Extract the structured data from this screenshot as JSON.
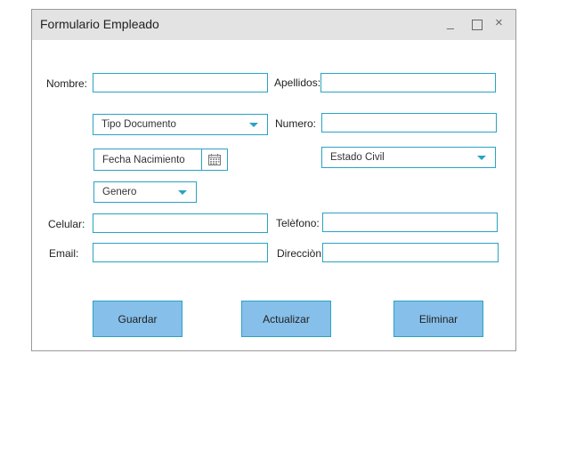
{
  "window": {
    "title": "Formulario Empleado",
    "minimize_glyph": "_",
    "close_glyph": "×"
  },
  "form": {
    "nombre_label": "Nombre:",
    "apellidos_label": "Apellidos:",
    "numero_label": "Numero:",
    "celular_label": "Celular:",
    "telefono_label": "Telèfono:",
    "email_label": "Email:",
    "direccion_label": "Direcciòn:",
    "tipo_documento": "Tipo Documento",
    "fecha_nacimiento": "Fecha Nacimiento",
    "estado_civil": "Estado Civil",
    "genero": "Genero"
  },
  "buttons": {
    "guardar": "Guardar",
    "actualizar": "Actualizar",
    "eliminar": "Eliminar"
  },
  "icons": {
    "calendar": "calendar-icon",
    "dropdown": "chevron-down-icon"
  },
  "colors": {
    "accent": "#2aa3c2",
    "button_fill": "#86bfea",
    "titlebar": "#e3e3e3"
  }
}
